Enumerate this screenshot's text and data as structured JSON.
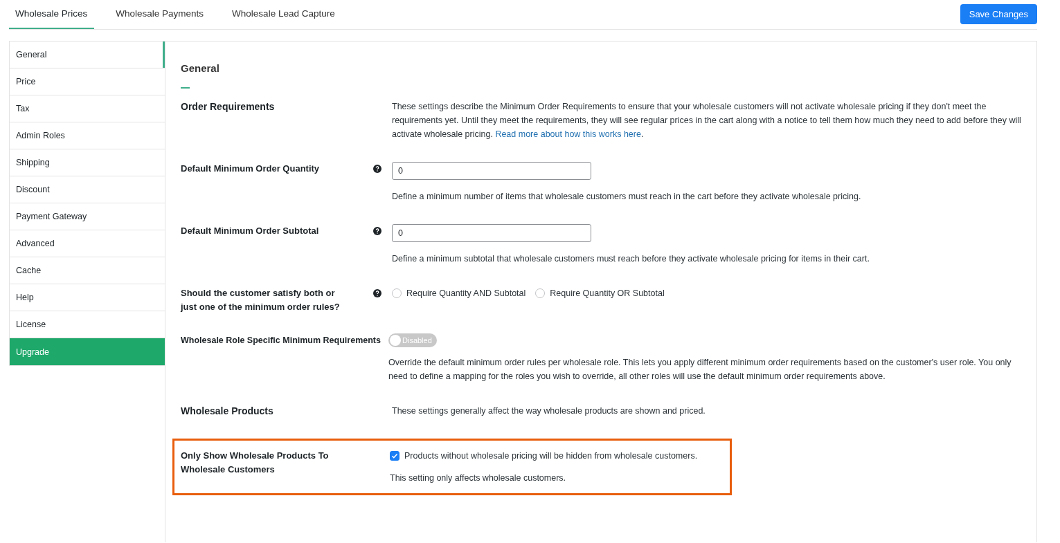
{
  "tabs": [
    {
      "label": "Wholesale Prices",
      "selected": true
    },
    {
      "label": "Wholesale Payments",
      "selected": false
    },
    {
      "label": "Wholesale Lead Capture",
      "selected": false
    }
  ],
  "save_button": "Save Changes",
  "sidebar": {
    "items": [
      {
        "label": "General",
        "selected": true,
        "kind": "normal"
      },
      {
        "label": "Price",
        "selected": false,
        "kind": "normal"
      },
      {
        "label": "Tax",
        "selected": false,
        "kind": "normal"
      },
      {
        "label": "Admin Roles",
        "selected": false,
        "kind": "normal"
      },
      {
        "label": "Shipping",
        "selected": false,
        "kind": "normal"
      },
      {
        "label": "Discount",
        "selected": false,
        "kind": "normal"
      },
      {
        "label": "Payment Gateway",
        "selected": false,
        "kind": "normal"
      },
      {
        "label": "Advanced",
        "selected": false,
        "kind": "normal"
      },
      {
        "label": "Cache",
        "selected": false,
        "kind": "normal"
      },
      {
        "label": "Help",
        "selected": false,
        "kind": "normal"
      },
      {
        "label": "License",
        "selected": false,
        "kind": "normal"
      },
      {
        "label": "Upgrade",
        "selected": false,
        "kind": "upgrade"
      }
    ]
  },
  "panel": {
    "title": "General",
    "rows": [
      {
        "kind": "section",
        "label": "Order Requirements",
        "description": "These settings describe the Minimum Order Requirements to ensure that your wholesale customers will not activate wholesale pricing if they don't meet the requirements yet. Until they meet the requirements, they will see regular prices in the cart along with a notice to tell them how much they need to add before they will activate wholesale pricing. ",
        "link": "Read more about how this works here",
        "description_end": "."
      },
      {
        "kind": "number",
        "label": "Default Minimum Order Quantity",
        "help": true,
        "value": "0",
        "description": "Define a minimum number of items that wholesale customers must reach in the cart before they activate wholesale pricing."
      },
      {
        "kind": "number",
        "label": "Default Minimum Order Subtotal",
        "help": true,
        "value": "0",
        "description": "Define a minimum subtotal that wholesale customers must reach before they activate wholesale pricing for items in their cart."
      },
      {
        "kind": "radio",
        "label": "Should the customer satisfy both or just one of the minimum order rules?",
        "help": true,
        "options": [
          {
            "label": "Require Quantity AND Subtotal",
            "selected": false
          },
          {
            "label": "Require Quantity OR Subtotal",
            "selected": false
          }
        ]
      },
      {
        "kind": "toggle",
        "label": "Wholesale Role Specific Minimum Requirements",
        "on": false,
        "toggle_label": "Disabled",
        "description": "Override the default minimum order rules per wholesale role. This lets you apply different minimum order requirements based on the customer's user role. You only need to define a mapping for the roles you wish to override, all other roles will use the default minimum order requirements above."
      },
      {
        "kind": "section",
        "label": "Wholesale Products",
        "description": "These settings generally affect the way wholesale products are shown and priced."
      },
      {
        "kind": "checkbox",
        "label": "Only Show Wholesale Products To Wholesale Customers",
        "highlighted": true,
        "checked": true,
        "checkbox_label": "Products without wholesale pricing will be hidden from wholesale customers.",
        "description": "This setting only affects wholesale customers."
      }
    ]
  }
}
